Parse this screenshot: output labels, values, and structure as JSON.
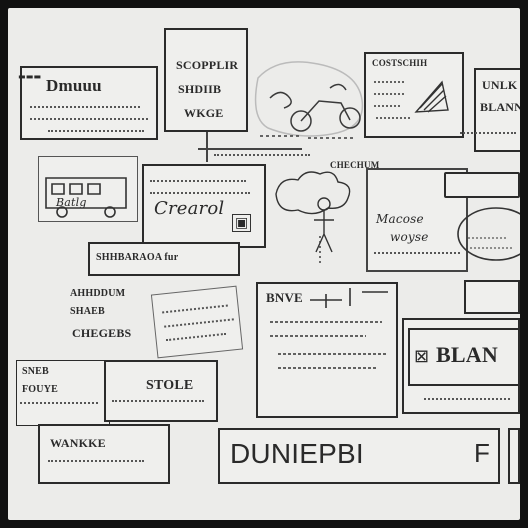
{
  "canvas": {
    "background": "#ececea",
    "frame": "#111111",
    "ink": "#2b2b2b"
  },
  "panels": {
    "header_left": {
      "title": "Dmuuu"
    },
    "top_mid": {
      "line1": "SCOPPLIR",
      "line2": "SHDIIB",
      "line3": "WKGE"
    },
    "sketch_top": {
      "caption": ""
    },
    "top_right": {
      "line1": "COSTSCHIH",
      "line2": "",
      "line3": ""
    },
    "far_right": {
      "line1": "UNLK",
      "line2": "BLANN",
      "line3": ""
    },
    "left_mid": {
      "label": "Batlg"
    },
    "center_card": {
      "heading": "Crearol",
      "script_word": "Crearol"
    },
    "banner_bar": {
      "text": "SHHBARAOA fur"
    },
    "right_mid": {
      "line1": "CHECHUM",
      "line2": "Macose",
      "line3": "woyse"
    },
    "left_block": {
      "line1": "AHHDDUM",
      "line2": "SHAEB",
      "line3": "CHEGEBS"
    },
    "center_block": {
      "title": "BNVE"
    },
    "blank_box": {
      "label": "BLAN"
    },
    "bottom_left_small": {
      "line1": "SNEB",
      "line2": "FOUYE"
    },
    "bottom_mid_small": {
      "text": "STOLE"
    },
    "bottom_left_frame": {
      "text": "WANKKE"
    },
    "footer_bar": {
      "title": "DUNIEPBI",
      "right_letter": "F"
    }
  }
}
